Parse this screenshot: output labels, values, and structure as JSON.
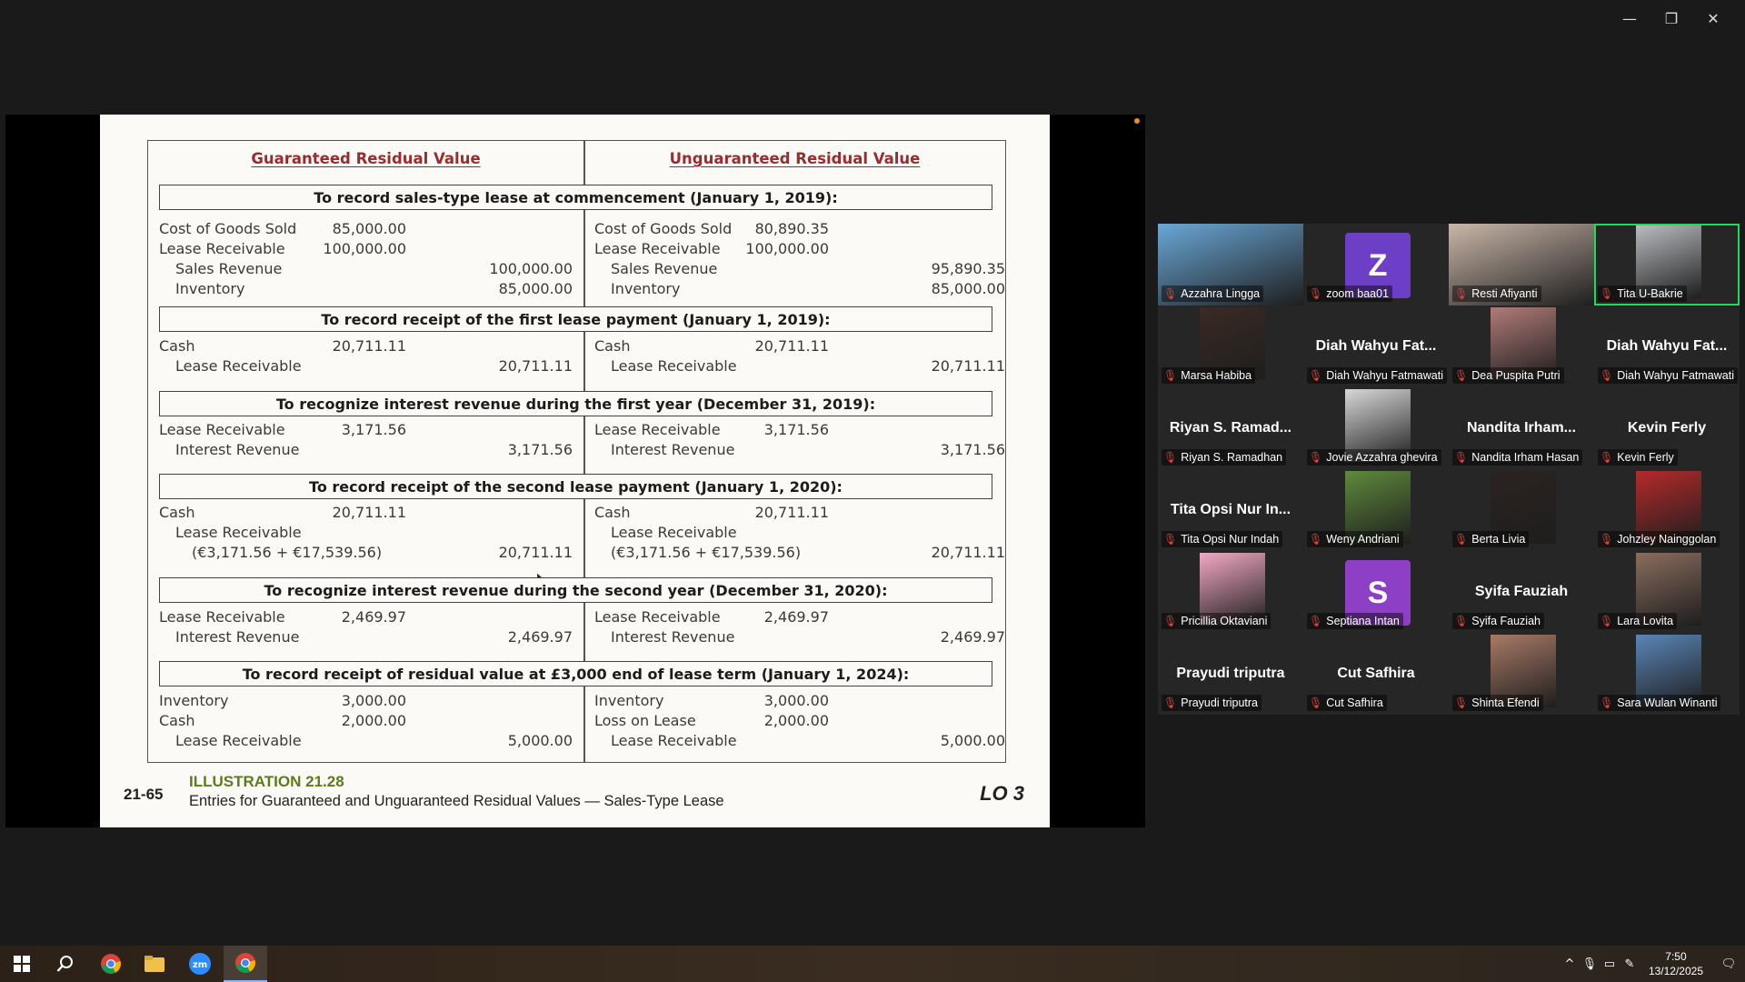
{
  "window": {
    "minimize": "—",
    "restore": "❐",
    "close": "✕"
  },
  "slide": {
    "headers": {
      "left": "Guaranteed Residual Value",
      "right": "Unguaranteed Residual Value"
    },
    "sections": [
      "To record sales-type lease at commencement (January 1, 2019):",
      "To record receipt of the first lease payment (January 1, 2019):",
      "To recognize interest revenue during the first year (December 31, 2019):",
      "To record receipt of the second lease payment (January 1, 2020):",
      "To recognize interest revenue during the second year (December 31, 2020):",
      "To record receipt of residual value at £3,000 end of lease term (January 1, 2024):"
    ],
    "left_rows": [
      [
        {
          "a": "Cost of Goods Sold",
          "d": "85,000.00",
          "c": ""
        },
        {
          "a": "Lease Receivable",
          "d": "100,000.00",
          "c": ""
        },
        {
          "a": "Sales Revenue",
          "d": "",
          "c": "100,000.00",
          "i": 1
        },
        {
          "a": "Inventory",
          "d": "",
          "c": "85,000.00",
          "i": 1
        }
      ],
      [
        {
          "a": "Cash",
          "d": "20,711.11",
          "c": ""
        },
        {
          "a": "Lease Receivable",
          "d": "",
          "c": "20,711.11",
          "i": 1
        }
      ],
      [
        {
          "a": "Lease Receivable",
          "d": "3,171.56",
          "c": ""
        },
        {
          "a": "Interest Revenue",
          "d": "",
          "c": "3,171.56",
          "i": 1
        }
      ],
      [
        {
          "a": "Cash",
          "d": "20,711.11",
          "c": ""
        },
        {
          "a": "Lease Receivable",
          "d": "",
          "c": "",
          "i": 1
        },
        {
          "a": "(€3,171.56 + €17,539.56)",
          "d": "",
          "c": "20,711.11",
          "i": 2
        }
      ],
      [
        {
          "a": "Lease Receivable",
          "d": "2,469.97",
          "c": ""
        },
        {
          "a": "Interest Revenue",
          "d": "",
          "c": "2,469.97",
          "i": 1
        }
      ],
      [
        {
          "a": "Inventory",
          "d": "3,000.00",
          "c": ""
        },
        {
          "a": "Cash",
          "d": "2,000.00",
          "c": ""
        },
        {
          "a": "Lease Receivable",
          "d": "",
          "c": "5,000.00",
          "i": 1
        }
      ]
    ],
    "right_rows": [
      [
        {
          "a": "Cost of Goods Sold",
          "d": "80,890.35",
          "c": ""
        },
        {
          "a": "Lease Receivable",
          "d": "100,000.00",
          "c": ""
        },
        {
          "a": "Sales Revenue",
          "d": "",
          "c": "95,890.35",
          "i": 1
        },
        {
          "a": "Inventory",
          "d": "",
          "c": "85,000.00",
          "i": 1
        }
      ],
      [
        {
          "a": "Cash",
          "d": "20,711.11",
          "c": ""
        },
        {
          "a": "Lease Receivable",
          "d": "",
          "c": "20,711.11",
          "i": 1
        }
      ],
      [
        {
          "a": "Lease Receivable",
          "d": "3,171.56",
          "c": ""
        },
        {
          "a": "Interest Revenue",
          "d": "",
          "c": "3,171.56",
          "i": 1
        }
      ],
      [
        {
          "a": "Cash",
          "d": "20,711.11",
          "c": ""
        },
        {
          "a": "Lease Receivable",
          "d": "",
          "c": "",
          "i": 1
        },
        {
          "a": "(€3,171.56 + €17,539.56)",
          "d": "",
          "c": "20,711.11",
          "i": 1
        }
      ],
      [
        {
          "a": "Lease Receivable",
          "d": "2,469.97",
          "c": ""
        },
        {
          "a": "Interest Revenue",
          "d": "",
          "c": "2,469.97",
          "i": 1
        }
      ],
      [
        {
          "a": "Inventory",
          "d": "3,000.00",
          "c": ""
        },
        {
          "a": "Loss on Lease",
          "d": "2,000.00",
          "c": ""
        },
        {
          "a": "Lease Receivable",
          "d": "",
          "c": "5,000.00",
          "i": 1
        }
      ]
    ],
    "footer": {
      "number": "21-65",
      "title": "ILLUSTRATION 21.28",
      "subtitle": "Entries for Guaranteed and Unguaranteed Residual Values — Sales-Type Lease",
      "lo": "LO 3"
    }
  },
  "participants": [
    {
      "label": "Azzahra Lingga",
      "big": "",
      "kind": "photo",
      "color": "#6aa7d6"
    },
    {
      "label": "zoom baa01",
      "big": "",
      "kind": "avatar",
      "avatar": "Z",
      "color": "#6d3fc6"
    },
    {
      "label": "Resti Afiyanti",
      "big": "",
      "kind": "photo",
      "color": "#c9b6a8"
    },
    {
      "label": "Tita U-Bakrie",
      "big": "",
      "kind": "photo",
      "color": "#b9bcc0",
      "active": true
    },
    {
      "label": "Marsa Habiba",
      "big": "",
      "kind": "photo",
      "color": "#3a2a24"
    },
    {
      "label": "Diah Wahyu Fatmawati",
      "big": "Diah Wahyu Fat...",
      "kind": "name"
    },
    {
      "label": "Dea Puspita Putri",
      "big": "",
      "kind": "photo",
      "color": "#b07b78"
    },
    {
      "label": "Diah Wahyu Fatmawati",
      "big": "Diah Wahyu Fat...",
      "kind": "name"
    },
    {
      "label": "Riyan S. Ramadhan",
      "big": "Riyan S. Ramad...",
      "kind": "name"
    },
    {
      "label": "Jovie Azzahra ghevira",
      "big": "",
      "kind": "photo",
      "color": "#d8d8d8"
    },
    {
      "label": "Nandita Irham Hasan",
      "big": "Nandita Irham...",
      "kind": "name"
    },
    {
      "label": "Kevin Ferly",
      "big": "Kevin Ferly",
      "kind": "name"
    },
    {
      "label": "Tita Opsi Nur Indah",
      "big": "Tita Opsi Nur In...",
      "kind": "name"
    },
    {
      "label": "Weny Andriani",
      "big": "",
      "kind": "photo",
      "color": "#5f8a3c"
    },
    {
      "label": "Berta Livia",
      "big": "",
      "kind": "photo",
      "color": "#2b2320"
    },
    {
      "label": "Johzley Nainggolan",
      "big": "",
      "kind": "photo",
      "color": "#b52a2a"
    },
    {
      "label": "Pricillia Oktaviani",
      "big": "",
      "kind": "photo",
      "color": "#f2a8c4"
    },
    {
      "label": "Septiana Intan",
      "big": "",
      "kind": "avatar",
      "avatar": "S",
      "color": "#8d3fc6"
    },
    {
      "label": "Syifa Fauziah",
      "big": "Syifa Fauziah",
      "kind": "name"
    },
    {
      "label": "Lara Lovita",
      "big": "",
      "kind": "photo",
      "color": "#8a6d5e"
    },
    {
      "label": "Prayudi triputra",
      "big": "Prayudi triputra",
      "kind": "name"
    },
    {
      "label": "Cut Safhira",
      "big": "Cut Safhira",
      "kind": "name"
    },
    {
      "label": "Shinta Efendi",
      "big": "",
      "kind": "photo",
      "color": "#a87a66"
    },
    {
      "label": "Sara Wulan Winanti",
      "big": "",
      "kind": "photo",
      "color": "#5a86b8"
    }
  ],
  "taskbar": {
    "time": "7:50",
    "date": "13/12/2025"
  }
}
